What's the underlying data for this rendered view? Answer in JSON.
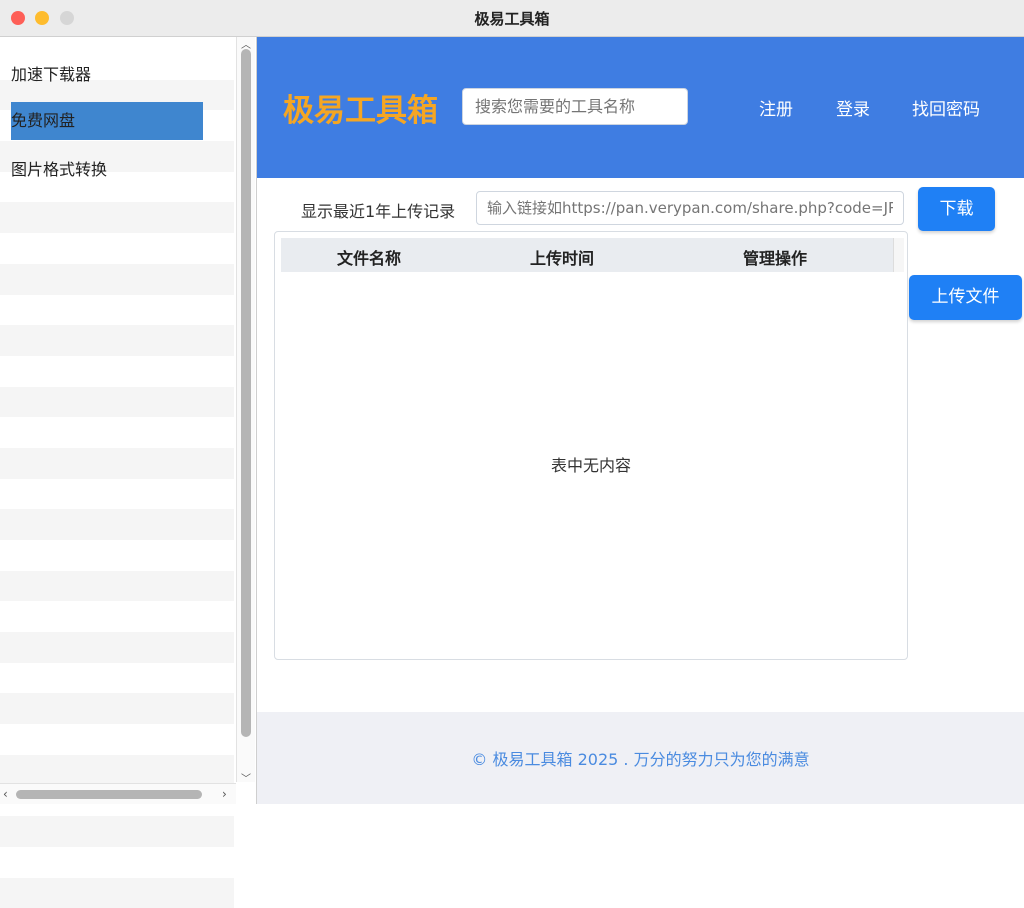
{
  "window": {
    "title": "极易工具箱"
  },
  "sidebar": {
    "items": [
      {
        "label": "加速下载器"
      },
      {
        "label": "免费网盘"
      },
      {
        "label": "图片格式转换"
      }
    ]
  },
  "header": {
    "brand": "极易工具箱",
    "search_placeholder": "搜索您需要的工具名称",
    "nav": {
      "register": "注册",
      "login": "登录",
      "recover": "找回密码"
    }
  },
  "main": {
    "history_label": "显示最近1年上传记录",
    "url_placeholder": "输入链接如https://pan.verypan.com/share.php?code=JRB",
    "download_button": "下载",
    "upload_button": "上传文件",
    "table": {
      "columns": [
        "文件名称",
        "上传时间",
        "管理操作"
      ],
      "empty_text": "表中无内容"
    }
  },
  "footer": {
    "text": "© 极易工具箱 2025 . 万分的努力只为您的满意"
  },
  "colors": {
    "header_bg": "#3f7de2",
    "brand": "#f5a623",
    "button": "#1f80f5",
    "selected": "#3f86cf"
  }
}
